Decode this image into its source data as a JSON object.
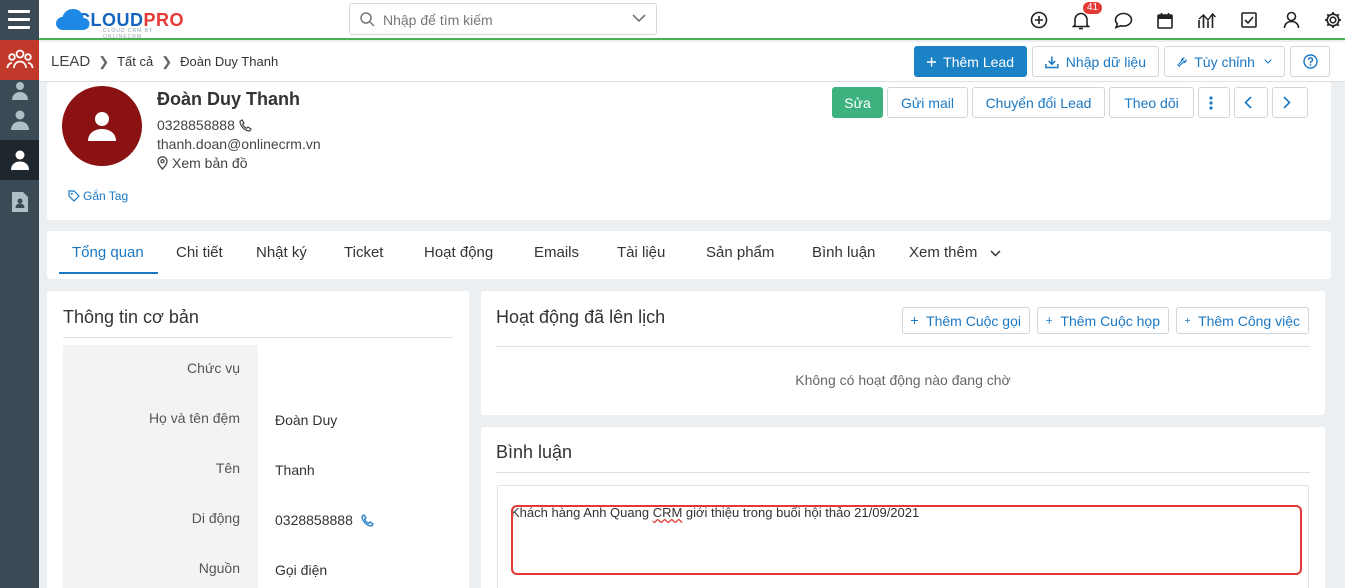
{
  "app": {
    "logo_main": "CLOUD",
    "logo_accent": "PRO",
    "logo_tagline": "CLOUD CRM BY ONLINECRM"
  },
  "search": {
    "placeholder": "Nhập để tìm kiếm"
  },
  "notifications": {
    "count": "41"
  },
  "breadcrumb": {
    "module": "LEAD",
    "filter": "Tất cả",
    "record": "Đoàn Duy Thanh"
  },
  "crumb_actions": {
    "add_lead": "Thêm Lead",
    "import": "Nhập dữ liệu",
    "customize": "Tùy chỉnh"
  },
  "lead": {
    "name": "Đoàn Duy Thanh",
    "phone": "0328858888",
    "email": "thanh.doan@onlinecrm.vn",
    "map_link": "Xem bản đồ",
    "tag_link": "Gắn Tag"
  },
  "header_actions": {
    "edit": "Sửa",
    "send_mail": "Gửi mail",
    "convert": "Chuyển đổi Lead",
    "follow": "Theo dõi"
  },
  "tabs": [
    {
      "label": "Tổng quan"
    },
    {
      "label": "Chi tiết"
    },
    {
      "label": "Nhật ký"
    },
    {
      "label": "Ticket"
    },
    {
      "label": "Hoạt động"
    },
    {
      "label": "Emails"
    },
    {
      "label": "Tài liệu"
    },
    {
      "label": "Sản phẩm"
    },
    {
      "label": "Bình luận"
    },
    {
      "label": "Xem thêm"
    }
  ],
  "basic_info": {
    "title": "Thông tin cơ bản",
    "fields": [
      {
        "label": "Chức vụ",
        "value": ""
      },
      {
        "label": "Họ và tên đệm",
        "value": "Đoàn Duy"
      },
      {
        "label": "Tên",
        "value": "Thanh"
      },
      {
        "label": "Di động",
        "value": "0328858888"
      },
      {
        "label": "Nguồn",
        "value": "Gọi điện"
      }
    ]
  },
  "scheduled": {
    "title": "Hoạt động đã lên lịch",
    "add_call": "Thêm Cuộc gọi",
    "add_meeting": "Thêm Cuộc họp",
    "add_task": "Thêm Công việc",
    "empty_text": "Không có hoạt động nào đang chờ"
  },
  "comments": {
    "title": "Bình luận",
    "text_before": "Khách hàng Anh Quang ",
    "text_underlined": "CRM",
    "text_after": " giới thiệu trong buổi hội thảo 21/09/2021"
  },
  "colors": {
    "accent": "#1b82c5",
    "success": "#3eb27e",
    "avatar": "#8b1212",
    "rail": "#3c4a55",
    "rail_active": "#c0392b",
    "highlight": "#e53935"
  }
}
